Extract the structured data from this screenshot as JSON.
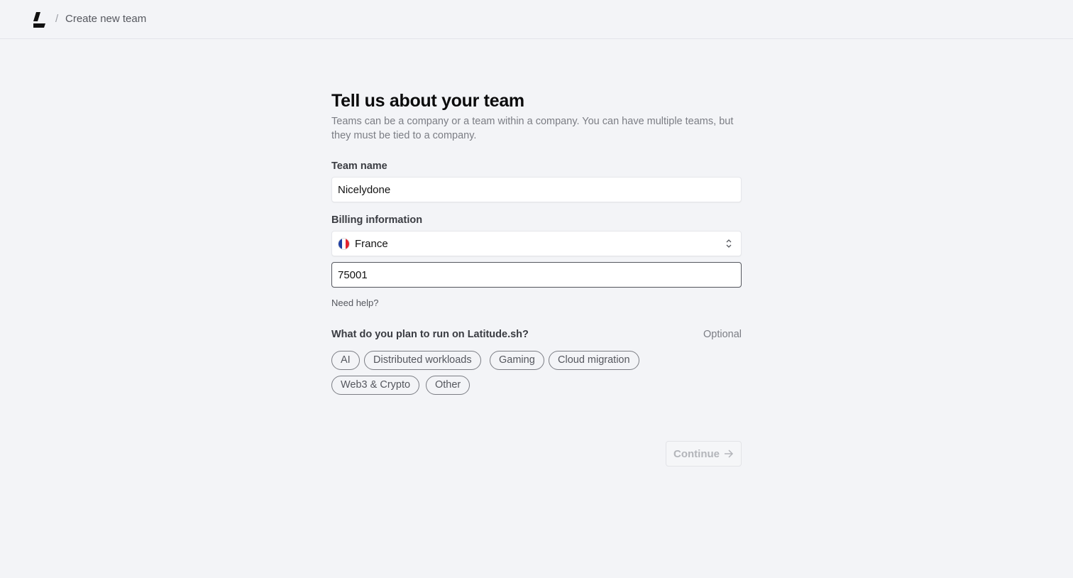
{
  "header": {
    "logo_icon": "latitude-logo-icon",
    "separator": "/",
    "title": "Create new team"
  },
  "form": {
    "heading": "Tell us about your team",
    "subtitle": "Teams can be a company or a team within a company. You can have multiple teams, but they must be tied to a company.",
    "team_name": {
      "label": "Team name",
      "value": "Nicelydone"
    },
    "billing": {
      "label": "Billing information",
      "country": "France",
      "country_flag_icon": "france-flag-icon",
      "postal_code": "75001",
      "help_link": "Need help?"
    },
    "usage": {
      "label": "What do you plan to run on Latitude.sh?",
      "optional": "Optional",
      "options": [
        "AI",
        "Distributed workloads",
        "Gaming",
        "Cloud migration",
        "Web3 & Crypto",
        "Other"
      ]
    },
    "continue_label": "Continue",
    "continue_icon": "arrow-right-icon"
  },
  "colors": {
    "background": "#f3f4f7",
    "text_primary": "#0b0b0c",
    "text_muted": "#7b7d84",
    "disabled_text": "#b3b5ba",
    "flag_blue": "#1f3fa3",
    "flag_red": "#e3232f"
  }
}
